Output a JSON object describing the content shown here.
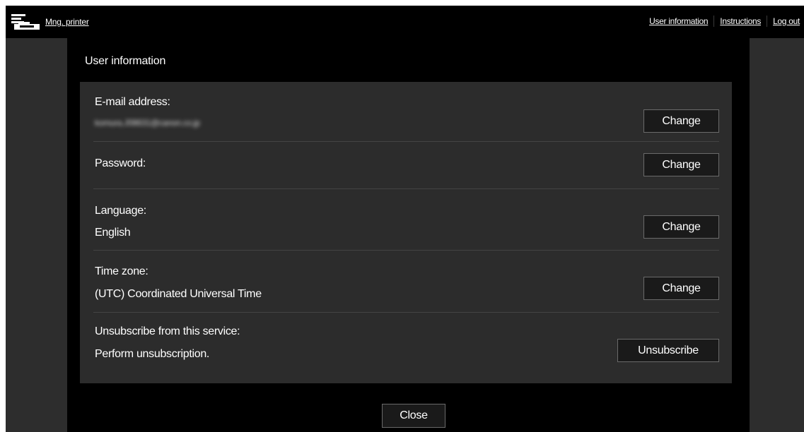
{
  "header": {
    "app_label": "Mng. printer",
    "app_icon": "printer-icon",
    "links": [
      "User information",
      "Instructions",
      "Log out"
    ]
  },
  "dialog": {
    "title": "User information",
    "rows": {
      "email": {
        "label": "E-mail address:",
        "value": "komura.J08631@canon.co.jp",
        "button": "Change"
      },
      "password": {
        "label": "Password:",
        "button": "Change"
      },
      "language": {
        "label": "Language:",
        "value": "English",
        "button": "Change"
      },
      "timezone": {
        "label": "Time zone:",
        "value": "(UTC) Coordinated Universal Time",
        "button": "Change"
      },
      "unsubscribe": {
        "label": "Unsubscribe from this service:",
        "value": "Perform unsubscription.",
        "button": "Unsubscribe"
      }
    },
    "close_label": "Close"
  },
  "colors": {
    "background": "#000000",
    "side_panel": "#2d2d2d",
    "content_panel": "#2c2c2c",
    "text": "#ffffff",
    "button_border": "#6a6a6a"
  }
}
